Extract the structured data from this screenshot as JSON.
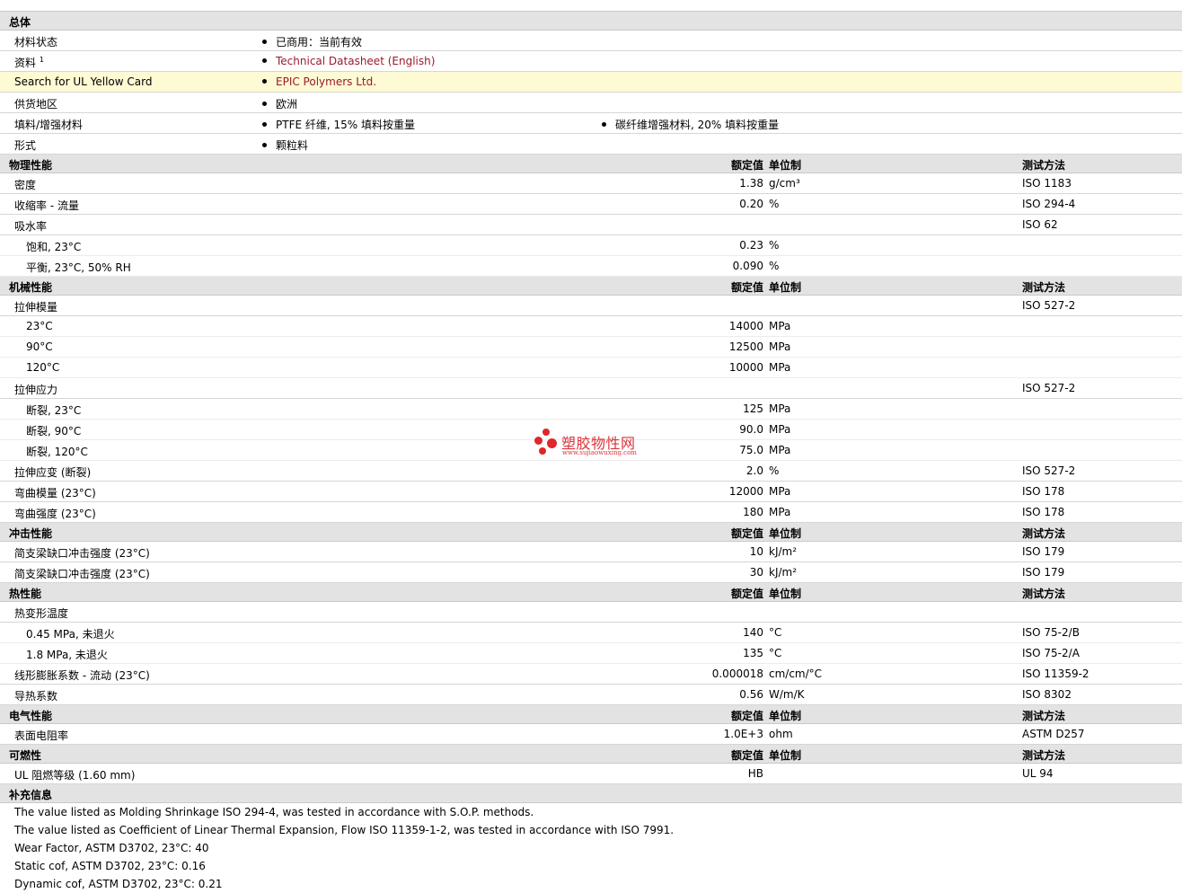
{
  "general": {
    "title": "总体",
    "rows": [
      {
        "label": "材料状态",
        "b1": "已商用：当前有效",
        "b2": ""
      },
      {
        "label": "资料",
        "sup": "1",
        "b1": "Technical Datasheet (English)",
        "b2": "",
        "link": true
      },
      {
        "label": "Search for UL Yellow Card",
        "b1": "EPIC Polymers Ltd.",
        "b2": "",
        "link": true,
        "highlight": true
      },
      {
        "label": "供货地区",
        "b1": "欧洲",
        "b2": ""
      },
      {
        "label": "填料/增强材料",
        "b1": "PTFE 纤维, 15% 填料按重量",
        "b2": "碳纤维增强材料, 20% 填料按重量"
      },
      {
        "label": "形式",
        "b1": "颗粒料",
        "b2": ""
      }
    ]
  },
  "sections": [
    {
      "title": "物理性能",
      "h_value": "额定值",
      "h_unit": "单位制",
      "h_test": "测试方法",
      "rows": [
        {
          "label": "密度",
          "value": "1.38",
          "unit": "g/cm³",
          "test": "ISO 1183"
        },
        {
          "label": "收缩率  - 流量",
          "value": "0.20",
          "unit": "%",
          "test": "ISO 294-4"
        },
        {
          "label": "吸水率",
          "value": "",
          "unit": "",
          "test": "ISO 62"
        },
        {
          "label": "饱和, 23°C",
          "value": "0.23",
          "unit": "%",
          "test": "",
          "sub": true
        },
        {
          "label": "平衡, 23°C, 50% RH",
          "value": "0.090",
          "unit": "%",
          "test": "",
          "sub": true
        }
      ]
    },
    {
      "title": "机械性能",
      "h_value": "额定值",
      "h_unit": "单位制",
      "h_test": "测试方法",
      "rows": [
        {
          "label": "拉伸模量",
          "value": "",
          "unit": "",
          "test": "ISO 527-2"
        },
        {
          "label": "23°C",
          "value": "14000",
          "unit": "MPa",
          "test": "",
          "sub": true
        },
        {
          "label": "90°C",
          "value": "12500",
          "unit": "MPa",
          "test": "",
          "sub": true
        },
        {
          "label": "120°C",
          "value": "10000",
          "unit": "MPa",
          "test": "",
          "sub": true
        },
        {
          "label": "拉伸应力",
          "value": "",
          "unit": "",
          "test": "ISO 527-2"
        },
        {
          "label": "断裂, 23°C",
          "value": "125",
          "unit": "MPa",
          "test": "",
          "sub": true
        },
        {
          "label": "断裂, 90°C",
          "value": "90.0",
          "unit": "MPa",
          "test": "",
          "sub": true
        },
        {
          "label": "断裂, 120°C",
          "value": "75.0",
          "unit": "MPa",
          "test": "",
          "sub": true
        },
        {
          "label": "拉伸应变  (断裂)",
          "value": "2.0",
          "unit": "%",
          "test": "ISO 527-2"
        },
        {
          "label": "弯曲模量  (23°C)",
          "value": "12000",
          "unit": "MPa",
          "test": "ISO 178"
        },
        {
          "label": "弯曲强度  (23°C)",
          "value": "180",
          "unit": "MPa",
          "test": "ISO 178"
        }
      ]
    },
    {
      "title": "冲击性能",
      "h_value": "额定值",
      "h_unit": "单位制",
      "h_test": "测试方法",
      "rows": [
        {
          "label": "简支梁缺口冲击强度  (23°C)",
          "value": "10",
          "unit": "kJ/m²",
          "test": "ISO 179"
        },
        {
          "label": "简支梁缺口冲击强度  (23°C)",
          "value": "30",
          "unit": "kJ/m²",
          "test": "ISO 179"
        }
      ]
    },
    {
      "title": "热性能",
      "h_value": "额定值",
      "h_unit": "单位制",
      "h_test": "测试方法",
      "rows": [
        {
          "label": "热变形温度",
          "value": "",
          "unit": "",
          "test": ""
        },
        {
          "label": "0.45 MPa, 未退火",
          "value": "140",
          "unit": "°C",
          "test": "ISO 75-2/B",
          "sub": true
        },
        {
          "label": "1.8 MPa, 未退火",
          "value": "135",
          "unit": "°C",
          "test": "ISO 75-2/A",
          "sub": true
        },
        {
          "label": "线形膨胀系数  - 流动  (23°C)",
          "value": "0.000018",
          "unit": "cm/cm/°C",
          "test": "ISO 11359-2"
        },
        {
          "label": "导热系数",
          "value": "0.56",
          "unit": "W/m/K",
          "test": "ISO 8302"
        }
      ]
    },
    {
      "title": "电气性能",
      "h_value": "额定值",
      "h_unit": "单位制",
      "h_test": "测试方法",
      "rows": [
        {
          "label": "表面电阻率",
          "value": "1.0E+3",
          "unit": "ohm",
          "test": "ASTM D257"
        }
      ]
    },
    {
      "title": "可燃性",
      "h_value": "额定值",
      "h_unit": "单位制",
      "h_test": "测试方法",
      "rows": [
        {
          "label": "UL 阻燃等级  (1.60 mm)",
          "value": "HB",
          "unit": "",
          "test": "UL 94"
        }
      ]
    }
  ],
  "supplemental": {
    "title": "补充信息",
    "notes": [
      "The value listed as Molding Shrinkage ISO 294-4, was tested in accordance with S.O.P. methods.",
      "The value listed as Coefficient of Linear Thermal Expansion, Flow ISO 11359-1-2, was tested in accordance with ISO 7991.",
      "Wear Factor, ASTM D3702, 23°C: 40",
      "Static cof, ASTM D3702, 23°C: 0.16",
      "Dynamic cof, ASTM D3702, 23°C: 0.21"
    ]
  },
  "watermark": {
    "cn": "塑胶物性网",
    "url": "www.sujiaowuxing.com",
    "color": "#e0262a"
  },
  "colors": {
    "section_bg": "#e3e3e3",
    "link": "#9a1a2c",
    "highlight_bg": "#fdfad4"
  }
}
